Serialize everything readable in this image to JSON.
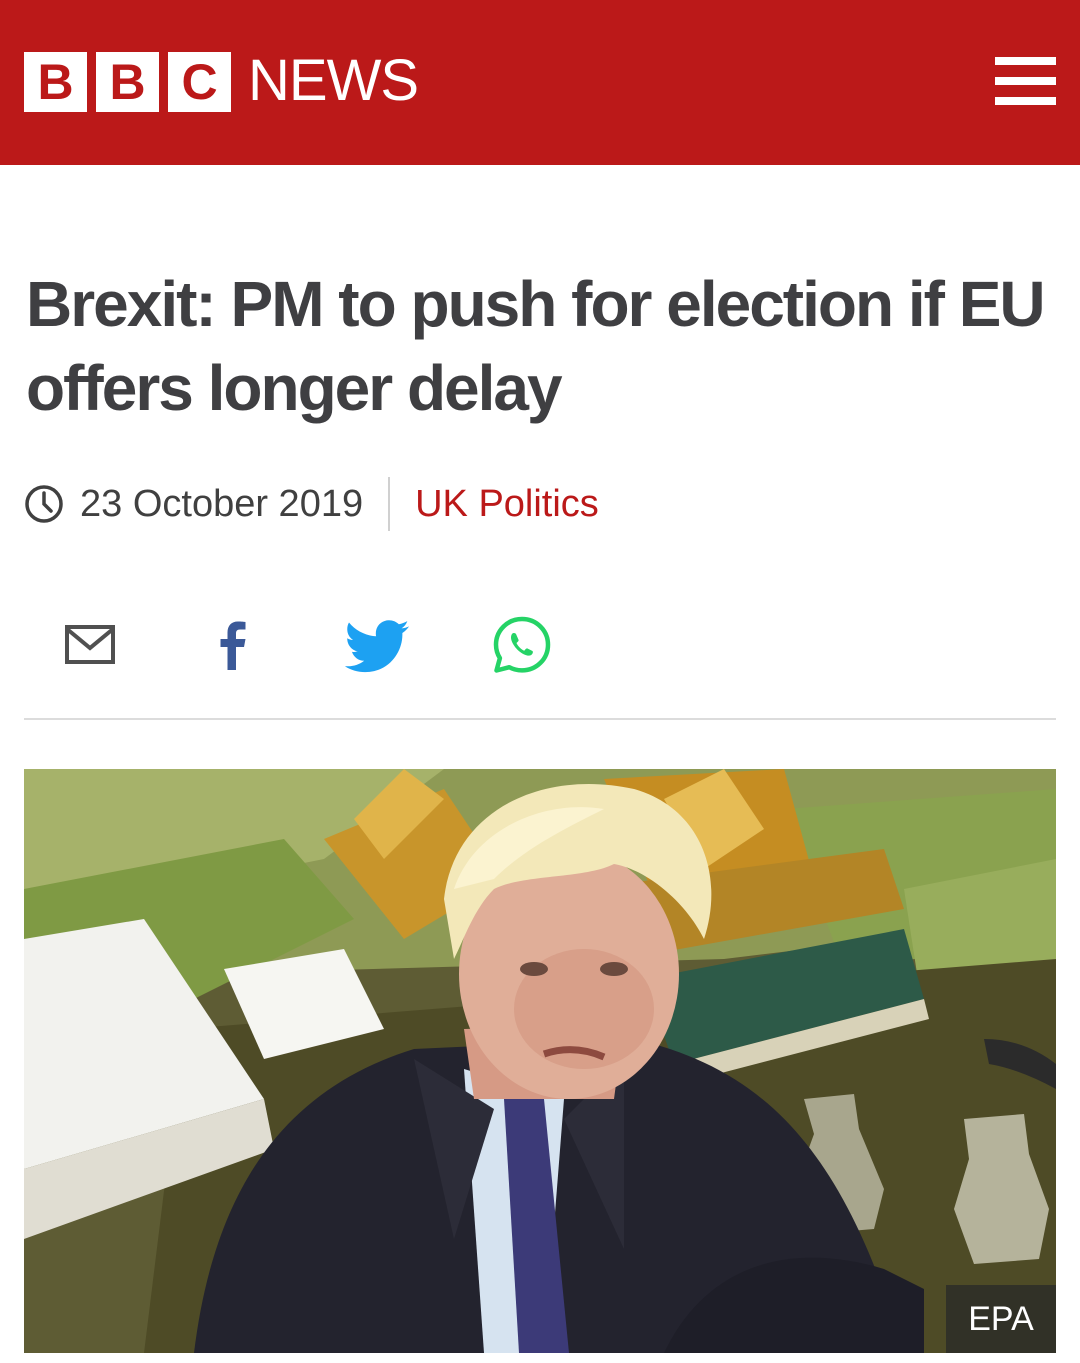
{
  "header": {
    "logo_letters": [
      "B",
      "B",
      "C"
    ],
    "brand_word": "NEWS",
    "menu_icon": "hamburger-menu-icon"
  },
  "article": {
    "headline": "Brexit: PM to push for election if EU offers longer delay",
    "date": "23 October 2019",
    "section": "UK Politics"
  },
  "share": {
    "icons": [
      "email-icon",
      "facebook-icon",
      "twitter-icon",
      "whatsapp-icon"
    ]
  },
  "image": {
    "credit": "EPA"
  },
  "colors": {
    "brand_red": "#bb1919",
    "headline": "#3f3f42",
    "facebook": "#3b5998",
    "twitter": "#1da1f2",
    "whatsapp": "#25d366"
  }
}
